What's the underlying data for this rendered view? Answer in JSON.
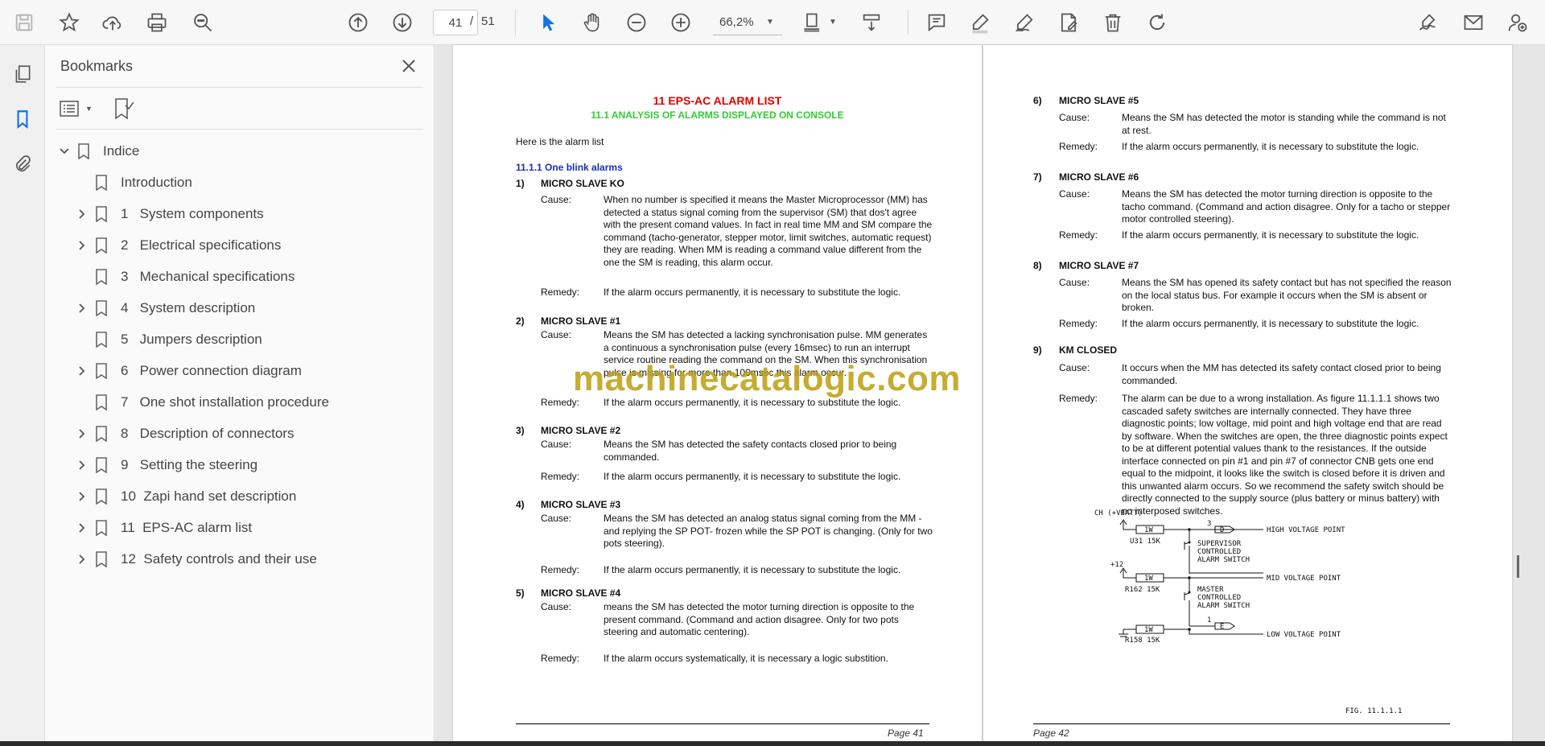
{
  "toolbar": {
    "current_page": "41",
    "separator": "/",
    "total_pages": "51",
    "zoom": "66,2%"
  },
  "bookmarks": {
    "title": "Bookmarks",
    "items": [
      {
        "label": "Indice",
        "level": 0,
        "expanded": true
      },
      {
        "label": "Introduction",
        "level": 1,
        "has_children": false
      },
      {
        "label": "1   System components",
        "level": 1,
        "has_children": true
      },
      {
        "label": "2   Electrical specifications",
        "level": 1,
        "has_children": true
      },
      {
        "label": "3   Mechanical specifications",
        "level": 1,
        "has_children": false
      },
      {
        "label": "4   System description",
        "level": 1,
        "has_children": true
      },
      {
        "label": "5   Jumpers description",
        "level": 1,
        "has_children": false
      },
      {
        "label": "6   Power connection diagram",
        "level": 1,
        "has_children": true
      },
      {
        "label": "7   One shot installation procedure",
        "level": 1,
        "has_children": false
      },
      {
        "label": "8   Description of connectors",
        "level": 1,
        "has_children": true
      },
      {
        "label": "9   Setting the steering",
        "level": 1,
        "has_children": true
      },
      {
        "label": "10  Zapi hand set description",
        "level": 1,
        "has_children": true
      },
      {
        "label": "11  EPS-AC alarm list",
        "level": 1,
        "has_children": true
      },
      {
        "label": "12  Safety controls and their use",
        "level": 1,
        "has_children": true
      }
    ]
  },
  "page41": {
    "title": "11 EPS-AC ALARM LIST",
    "subtitle": "11.1 ANALYSIS OF ALARMS DISPLAYED ON CONSOLE",
    "intro": "Here is the alarm list",
    "section": "11.1.1 One blink alarms",
    "cause_label": "Cause:",
    "remedy_label": "Remedy:",
    "alarms": [
      {
        "num": "1)",
        "name": "MICRO SLAVE KO",
        "cause": "When no number is specified it means the Master Microprocessor (MM) has detected a status signal coming from the supervisor (SM) that dos't agree with the present comand values. In fact in real time MM and SM compare the command (tacho-generator, stepper motor, limit switches, automatic request) they are reading. When MM is reading a command value different from the one the SM is reading, this alarm occur.",
        "remedy": "If the alarm occurs permanently, it is necessary to substitute the logic."
      },
      {
        "num": "2)",
        "name": "MICRO SLAVE #1",
        "cause": "Means the SM has detected a lacking synchronisation pulse. MM generates a continuous  a synchronisation pulse (every 16msec) to run an interrupt service routine reading the command on the SM. When this synchronisation pulse is missing for more than 100msec this alarm occur.",
        "remedy": "If the alarm occurs permanently, it is necessary to substitute the logic."
      },
      {
        "num": "3)",
        "name": "MICRO SLAVE #2",
        "cause": "Means the SM has detected the safety contacts closed prior to being commanded.",
        "remedy": "If the alarm occurs permanently, it is necessary to substitute the logic."
      },
      {
        "num": "4)",
        "name": "MICRO SLAVE #3",
        "cause": "Means the SM has detected an analog status signal coming from the MM -and replying the SP POT- frozen while the SP POT is changing. (Only for two pots steering).",
        "remedy": "If the alarm occurs permanently, it is necessary to substitute the logic."
      },
      {
        "num": "5)",
        "name": "MICRO SLAVE #4",
        "cause": "means the SM has detected the motor turning direction is opposite to the present command. (Command and action disagree. Only for two pots steering and automatic centering).",
        "remedy": "If the alarm occurs systematically, it is necessary a logic substition."
      }
    ],
    "footer": "Page 41"
  },
  "page42": {
    "alarms": [
      {
        "num": "6)",
        "name": "MICRO SLAVE #5",
        "cause": "Means the SM has detected the motor is standing while the command is not at rest.",
        "remedy": "If the alarm occurs permanently, it is necessary to substitute the logic."
      },
      {
        "num": "7)",
        "name": "MICRO SLAVE #6",
        "cause": "Means the SM has detected the motor turning direction is opposite to the tacho command. (Command and action disagree. Only for a tacho or stepper motor controlled steering).",
        "remedy": "If the alarm occurs permanently, it is necessary to substitute the logic."
      },
      {
        "num": "8)",
        "name": "MICRO SLAVE #7",
        "cause": "Means the SM has opened its safety contact but has not specified the reason on the local status bus. For example it occurs when the SM is absent or broken.",
        "remedy": "If the alarm occurs permanently, it is necessary to substitute the logic."
      },
      {
        "num": "9)",
        "name": "KM CLOSED",
        "cause": "It occurs when the MM has detected its safety contact closed prior to being commanded.",
        "remedy": "The alarm can be due to a wrong installation. As figure 11.1.1.1 shows two cascaded safety switches are internally connected. They have three diagnostic points; low voltage, mid point and high voltage end that are read by software. When the switches are open, the three diagnostic points expect to be at different potential values thank to the resistances. If the outside interface connected on pin #1 and pin #7 of connector CNB gets one end equal to the midpoint, it looks like the switch is closed before it is driven and this unwanted alarm occurs. So we recommend the safety switch should be directly connected to the supply source (plus battery or minus battery) with no interposed switches."
      }
    ],
    "figure": {
      "supply": "CH (+VBATT)",
      "plus12": "+12",
      "high": "HIGH VOLTAGE POINT",
      "mid": "MID VOLTAGE POINT",
      "low": "LOW VOLTAGE POINT",
      "sup_switch": [
        "SUPERVISOR",
        "CONTROLLED",
        "ALARM SWITCH"
      ],
      "mas_switch": [
        "MASTER",
        "CONTROLLED",
        "ALARM SWITCH"
      ],
      "r1": "U31  15K",
      "r2": "R162  15K",
      "r3": "R158  15K",
      "rw": "1W",
      "pin_d": "D",
      "pin_e": "E",
      "pin3": "3",
      "pin1": "1",
      "caption": "FIG. 11.1.1.1"
    },
    "footer": "Page 42"
  },
  "watermark": "machinecatalogic.com"
}
